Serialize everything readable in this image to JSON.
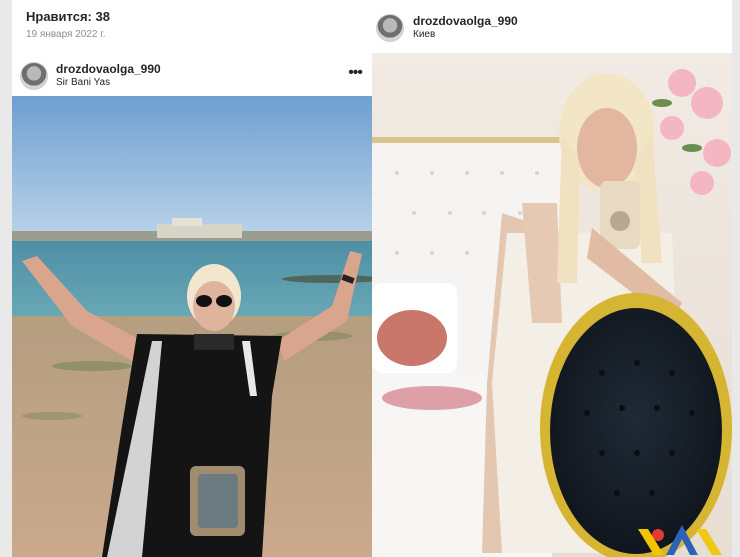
{
  "left_post": {
    "likes": "Нравится: 38",
    "date": "19 января 2022 г.",
    "username": "drozdovaolga_990",
    "location": "Sir Bani Yas",
    "more_icon": "more-horizontal-icon",
    "more_glyph": "•••"
  },
  "right_post": {
    "username": "drozdovaolga_990",
    "location": "Киев"
  },
  "watermark": {
    "icon": "brand-logo-icon",
    "colors": {
      "red": "#e53935",
      "yellow": "#f2c400",
      "blue": "#2b63b8"
    }
  }
}
